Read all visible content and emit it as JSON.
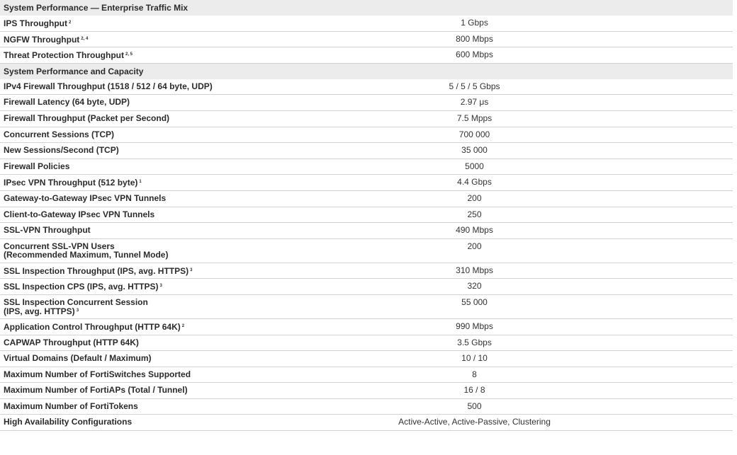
{
  "sections": [
    {
      "title": "System Performance — Enterprise Traffic Mix",
      "rows": [
        {
          "label": "IPS Throughput",
          "sup": "2",
          "value": "1 Gbps"
        },
        {
          "label": "NGFW Throughput",
          "sup": "2, 4",
          "value": "800 Mbps"
        },
        {
          "label": "Threat Protection Throughput",
          "sup": "2, 5",
          "value": "600 Mbps"
        }
      ]
    },
    {
      "title": "System Performance and Capacity",
      "rows": [
        {
          "label": "IPv4 Firewall Throughput (1518 / 512 / 64 byte, UDP)",
          "sup": "",
          "value": "5 / 5 / 5 Gbps"
        },
        {
          "label": "Firewall Latency (64 byte, UDP)",
          "sup": "",
          "value": "2.97 μs"
        },
        {
          "label": "Firewall Throughput (Packet per Second)",
          "sup": "",
          "value": "7.5 Mpps"
        },
        {
          "label": "Concurrent Sessions (TCP)",
          "sup": "",
          "value": "700 000"
        },
        {
          "label": "New Sessions/Second (TCP)",
          "sup": "",
          "value": "35 000"
        },
        {
          "label": "Firewall Policies",
          "sup": "",
          "value": "5000"
        },
        {
          "label": "IPsec VPN Throughput (512 byte)",
          "sup": "1",
          "value": "4.4 Gbps"
        },
        {
          "label": "Gateway-to-Gateway IPsec VPN Tunnels",
          "sup": "",
          "value": "200"
        },
        {
          "label": "Client-to-Gateway IPsec VPN Tunnels",
          "sup": "",
          "value": "250"
        },
        {
          "label": "SSL-VPN Throughput",
          "sup": "",
          "value": "490 Mbps"
        },
        {
          "label": "Concurrent SSL-VPN Users",
          "label2": "(Recommended Maximum, Tunnel Mode)",
          "sup": "",
          "value": "200"
        },
        {
          "label": "SSL Inspection Throughput (IPS, avg. HTTPS)",
          "sup": "3",
          "value": "310 Mbps"
        },
        {
          "label": "SSL Inspection CPS (IPS, avg. HTTPS)",
          "sup": "3",
          "value": "320"
        },
        {
          "label": "SSL Inspection Concurrent Session",
          "label2": "(IPS, avg. HTTPS)",
          "sup": "",
          "sup2": "3",
          "value": "55 000"
        },
        {
          "label": "Application Control Throughput (HTTP 64K)",
          "sup": "2",
          "value": "990 Mbps"
        },
        {
          "label": "CAPWAP Throughput (HTTP 64K)",
          "sup": "",
          "value": "3.5 Gbps"
        },
        {
          "label": "Virtual Domains (Default / Maximum)",
          "sup": "",
          "value": "10 / 10"
        },
        {
          "label": "Maximum Number of FortiSwitches Supported",
          "sup": "",
          "value": "8"
        },
        {
          "label": "Maximum Number of FortiAPs (Total / Tunnel)",
          "sup": "",
          "value": "16 / 8"
        },
        {
          "label": "Maximum Number of FortiTokens",
          "sup": "",
          "value": "500"
        },
        {
          "label": "High Availability Configurations",
          "sup": "",
          "value": "Active-Active, Active-Passive, Clustering"
        }
      ]
    }
  ]
}
